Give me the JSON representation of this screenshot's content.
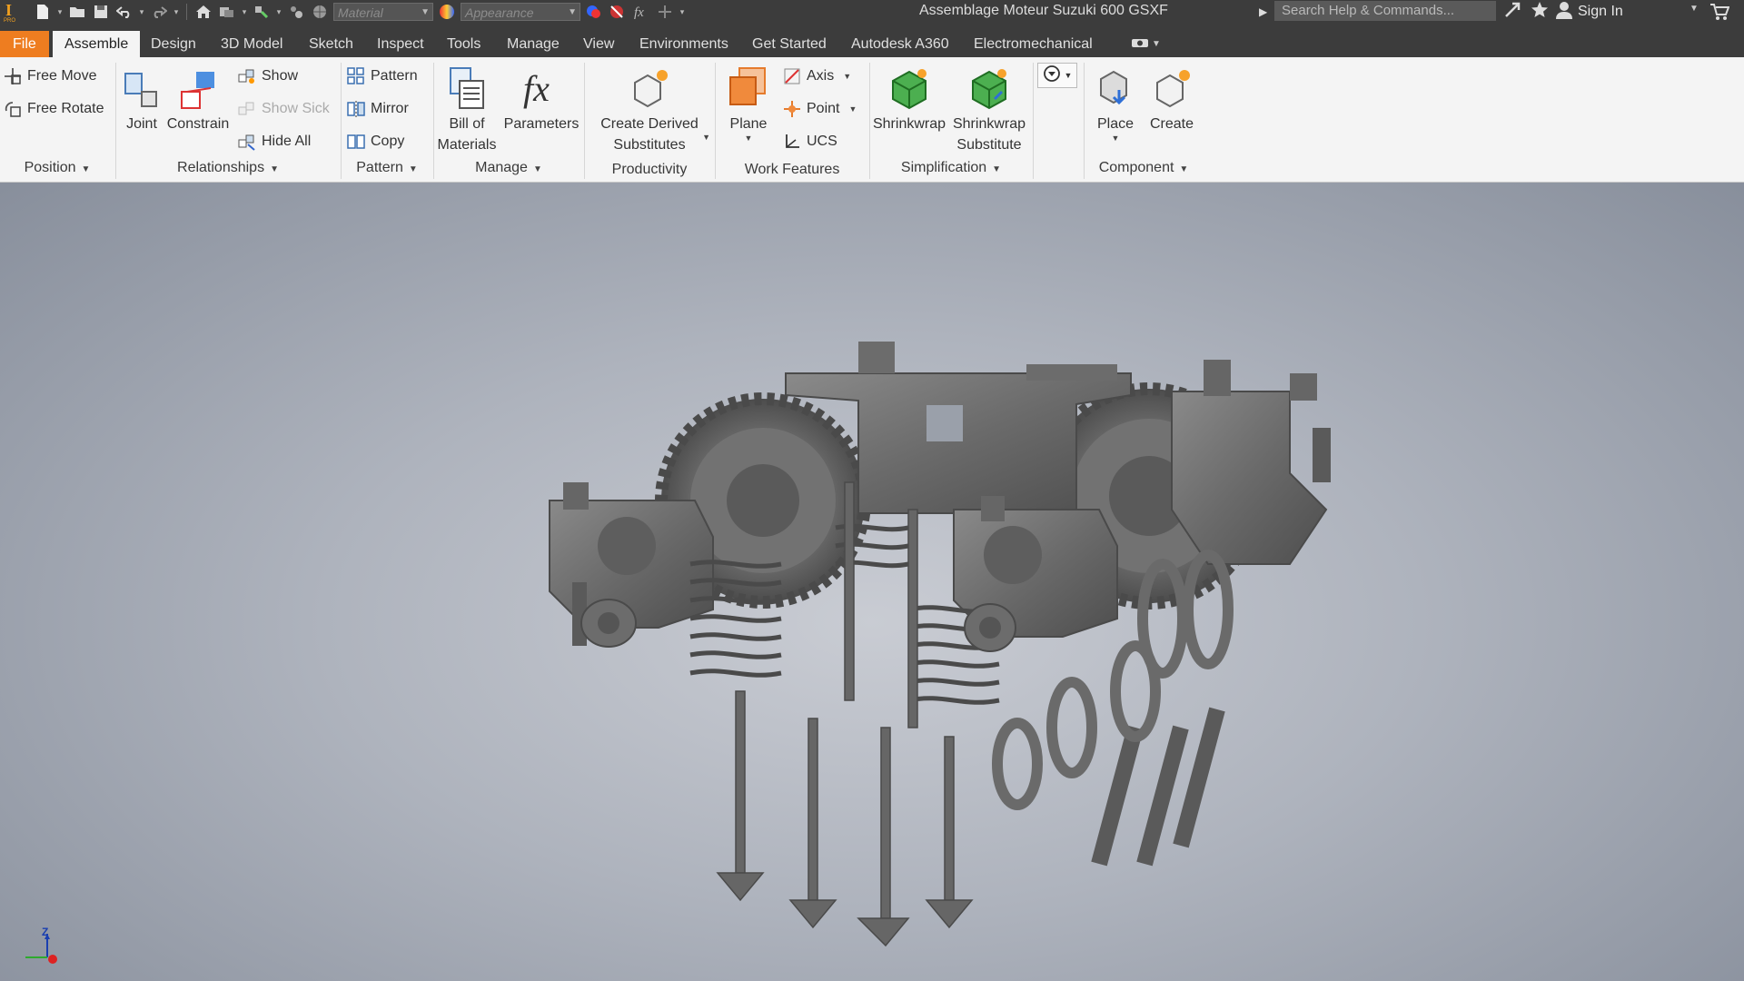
{
  "titlebar": {
    "document_title": "Assemblage Moteur Suzuki 600 GSXF",
    "material_placeholder": "Material",
    "appearance_placeholder": "Appearance",
    "search_placeholder": "Search Help & Commands...",
    "sign_in": "Sign In"
  },
  "tabs": {
    "file": "File",
    "assemble": "Assemble",
    "design": "Design",
    "model3d": "3D Model",
    "sketch": "Sketch",
    "inspect": "Inspect",
    "tools": "Tools",
    "manage": "Manage",
    "view": "View",
    "environments": "Environments",
    "get_started": "Get Started",
    "a360": "Autodesk A360",
    "electromechanical": "Electromechanical"
  },
  "ribbon": {
    "position": {
      "label": "Position",
      "free_move": "Free Move",
      "free_rotate": "Free Rotate"
    },
    "relationships": {
      "label": "Relationships",
      "joint": "Joint",
      "constrain": "Constrain",
      "show": "Show",
      "show_sick": "Show Sick",
      "hide_all": "Hide All"
    },
    "pattern": {
      "label": "Pattern",
      "pattern": "Pattern",
      "mirror": "Mirror",
      "copy": "Copy"
    },
    "manage": {
      "label": "Manage",
      "bom_line1": "Bill of",
      "bom_line2": "Materials",
      "parameters": "Parameters"
    },
    "productivity": {
      "label": "Productivity",
      "cds_line1": "Create Derived",
      "cds_line2": "Substitutes"
    },
    "work_features": {
      "label": "Work Features",
      "plane": "Plane",
      "axis": "Axis",
      "point": "Point",
      "ucs": "UCS"
    },
    "simplification": {
      "label": "Simplification",
      "shrinkwrap": "Shrinkwrap",
      "sws_line1": "Shrinkwrap",
      "sws_line2": "Substitute"
    },
    "component": {
      "label": "Component",
      "place": "Place",
      "create": "Create"
    }
  },
  "viewport": {
    "triad_z": "Z"
  },
  "colors": {
    "chrome": "#3c3c3c",
    "file_tab": "#ee7d20",
    "ribbon": "#f4f4f4",
    "part_gray": "#707070"
  }
}
